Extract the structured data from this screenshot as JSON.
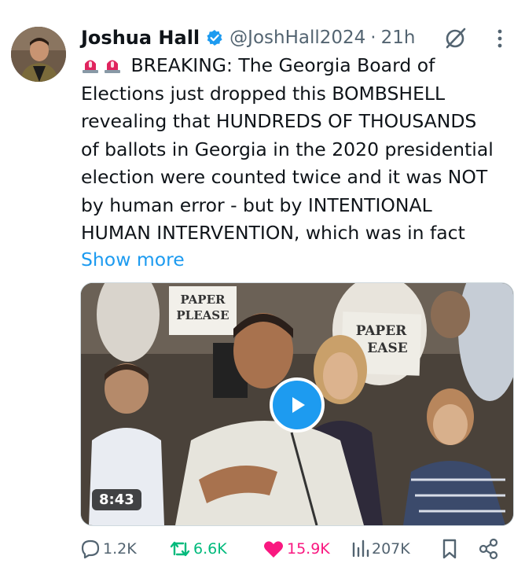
{
  "tweet": {
    "author": {
      "display_name": "Joshua Hall",
      "handle": "@JoshHall2024",
      "verified": true,
      "time": "21h"
    },
    "text_prefix_icons": [
      "siren-icon",
      "siren-icon"
    ],
    "text": "BREAKING: The Georgia Board of\nElections just dropped this BOMBSHELL\nrevealing that HUNDREDS OF THOUSANDS\nof ballots in Georgia in the 2020 presidential\nelection were counted twice and it was NOT\nby human error - but by INTENTIONAL\nHUMAN INTERVENTION, which was in fact",
    "show_more": "Show more",
    "media": {
      "type": "video",
      "duration": "8:43",
      "signs": [
        "PAPER",
        "PLEASE",
        "PAPER",
        "EASE"
      ]
    },
    "metrics": {
      "replies": "1.2K",
      "reposts": "6.6K",
      "likes": "15.9K",
      "views": "207K"
    }
  },
  "colors": {
    "accent": "#1d9bf0",
    "repost": "#00ba7c",
    "like": "#f91880",
    "secondary_text": "#536471"
  }
}
